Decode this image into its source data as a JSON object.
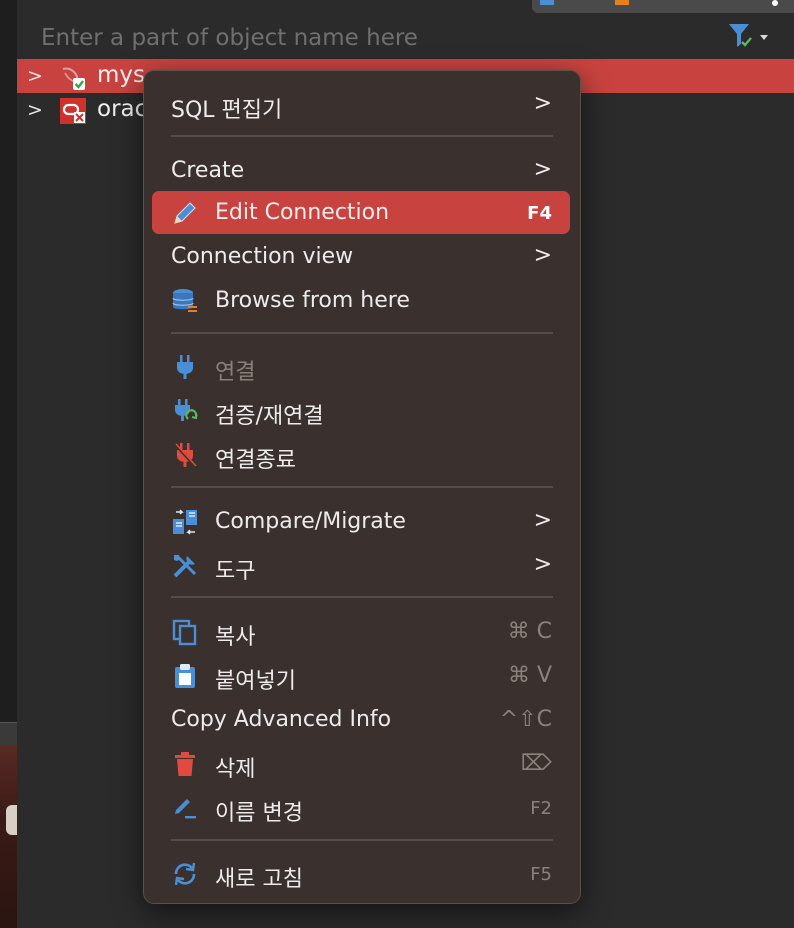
{
  "search": {
    "placeholder": "Enter a part of object name here"
  },
  "tree": {
    "items": [
      {
        "label": "mys",
        "state": "selected"
      },
      {
        "label": "orac",
        "state": "normal"
      }
    ]
  },
  "menu": {
    "items": [
      {
        "id": "sql-editor",
        "label": "SQL 편집기",
        "submenu": true
      },
      {
        "id": "create",
        "label": "Create",
        "submenu": true
      },
      {
        "id": "edit-connection",
        "label": "Edit Connection",
        "shortcut": "F4",
        "highlighted": true,
        "icon": "pencil-icon"
      },
      {
        "id": "connection-view",
        "label": "Connection view",
        "submenu": true
      },
      {
        "id": "browse-from-here",
        "label": "Browse from here",
        "icon": "database-icon"
      },
      {
        "id": "connect",
        "label": "연결",
        "disabled": true,
        "icon": "plug-icon"
      },
      {
        "id": "validate-reconnect",
        "label": "검증/재연결",
        "icon": "plug-refresh-icon"
      },
      {
        "id": "disconnect",
        "label": "연결종료",
        "icon": "plug-off-icon"
      },
      {
        "id": "compare-migrate",
        "label": "Compare/Migrate",
        "submenu": true,
        "icon": "compare-icon"
      },
      {
        "id": "tools",
        "label": "도구",
        "submenu": true,
        "icon": "tools-icon"
      },
      {
        "id": "copy",
        "label": "복사",
        "shortcut": "⌘ C",
        "icon": "copy-icon"
      },
      {
        "id": "paste",
        "label": "붙여넣기",
        "shortcut": "⌘ V",
        "icon": "paste-icon"
      },
      {
        "id": "copy-advanced",
        "label": "Copy Advanced Info",
        "shortcut": "^⇧C"
      },
      {
        "id": "delete",
        "label": "삭제",
        "shortcut": "⌦",
        "icon": "trash-icon"
      },
      {
        "id": "rename",
        "label": "이름 변경",
        "shortcut": "F2",
        "icon": "rename-icon"
      },
      {
        "id": "refresh",
        "label": "새로 고침",
        "shortcut": "F5",
        "icon": "refresh-icon"
      }
    ]
  },
  "colors": {
    "selection": "#c8433f",
    "menu_bg": "#3a302d",
    "icon_blue": "#4a8fd6",
    "icon_red": "#e04a3f",
    "icon_green": "#5cb85c"
  }
}
